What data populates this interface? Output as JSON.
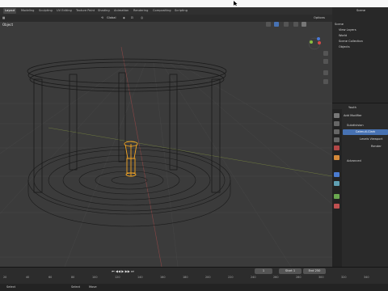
{
  "workspace_tabs": [
    "Layout",
    "Modeling",
    "Sculpting",
    "UV Editing",
    "Texture Paint",
    "Shading",
    "Animation",
    "Rendering",
    "Compositing",
    "Scripting"
  ],
  "viewport_header": {
    "orientation_label": "Global",
    "options_label": "Options"
  },
  "viewport": {
    "mode_label": "Object"
  },
  "outliner": {
    "search_label": "Scene",
    "rows": [
      {
        "label": "Scene"
      },
      {
        "label": "View Layers"
      },
      {
        "label": "World"
      },
      {
        "label": "Scene Collection"
      },
      {
        "label": "Objects"
      }
    ]
  },
  "properties": {
    "object_name": "Youth",
    "add_modifier_label": "Add Modifier",
    "modifier_name": "Subdivision",
    "catmull_label": "Catmull-Clark",
    "levels_viewport_label": "Levels Viewport",
    "render_label": "Render",
    "advanced_label": "Advanced"
  },
  "timeline": {
    "ruler": [
      "20",
      "40",
      "60",
      "80",
      "100",
      "120",
      "140",
      "160",
      "180",
      "200",
      "220",
      "240",
      "260",
      "280",
      "300",
      "320",
      "340"
    ],
    "start_label": "Start",
    "start_value": "1",
    "end_label": "End",
    "end_value": "250",
    "current_frame": "1"
  },
  "statusbar": {
    "left": "Select",
    "mid_a": "Select",
    "mid_b": "Move"
  },
  "colors": {
    "accent": "#4772b3",
    "selection": "#f5a623",
    "viewport_bg": "#3b3b3b"
  }
}
